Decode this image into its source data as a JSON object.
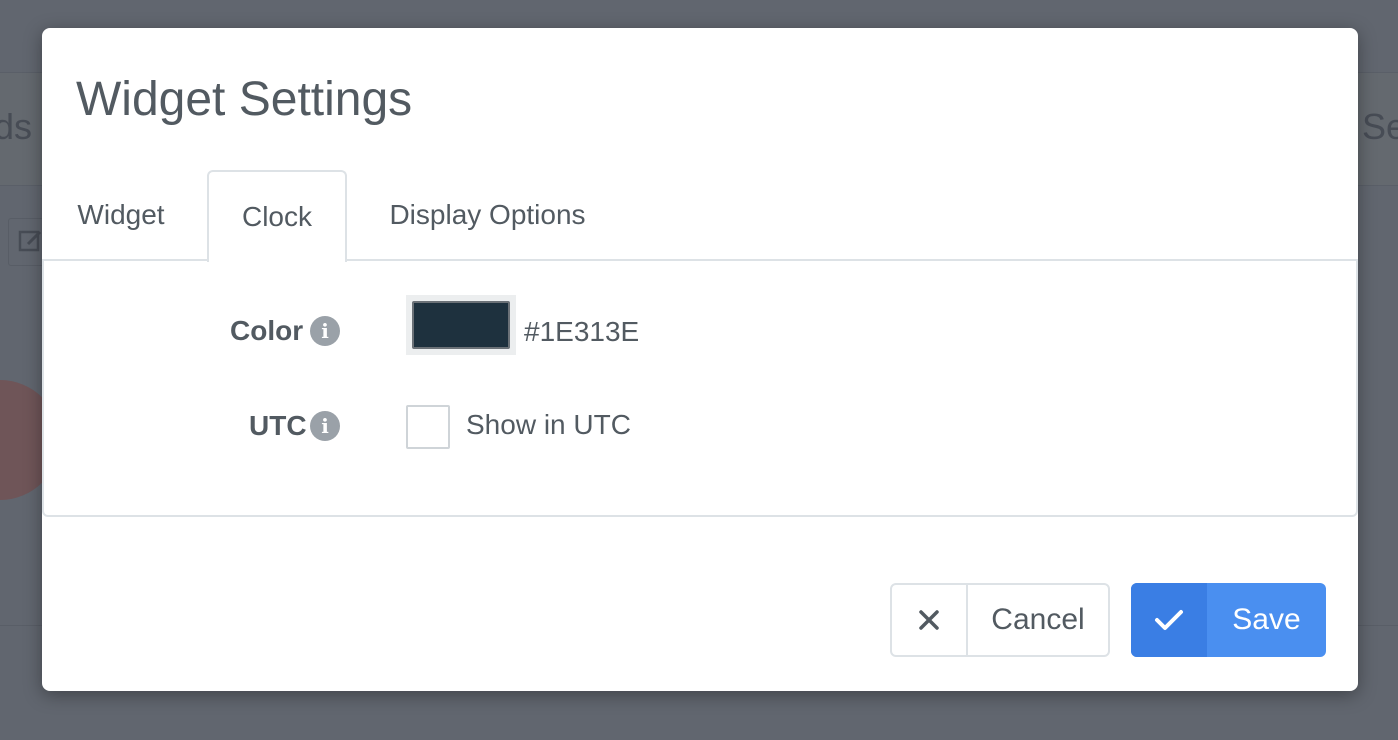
{
  "background": {
    "left_partial_text": "ds",
    "right_partial_text": "Se"
  },
  "modal": {
    "title": "Widget Settings",
    "tabs": [
      {
        "label": "Widget",
        "active": false
      },
      {
        "label": "Clock",
        "active": true
      },
      {
        "label": "Display Options",
        "active": false
      }
    ],
    "fields": {
      "color": {
        "label": "Color",
        "value": "#1E313E",
        "info_icon": "info-icon"
      },
      "utc": {
        "label": "UTC",
        "checkbox_label": "Show in UTC",
        "checked": false,
        "info_icon": "info-icon"
      }
    },
    "buttons": {
      "cancel": {
        "label": "Cancel",
        "icon": "close-icon"
      },
      "save": {
        "label": "Save",
        "icon": "checkmark-icon"
      }
    }
  },
  "colors": {
    "accent": "#4A8FF0",
    "accent_dark": "#3A7EE4",
    "text": "#525A61",
    "overlay": "#61666F"
  }
}
